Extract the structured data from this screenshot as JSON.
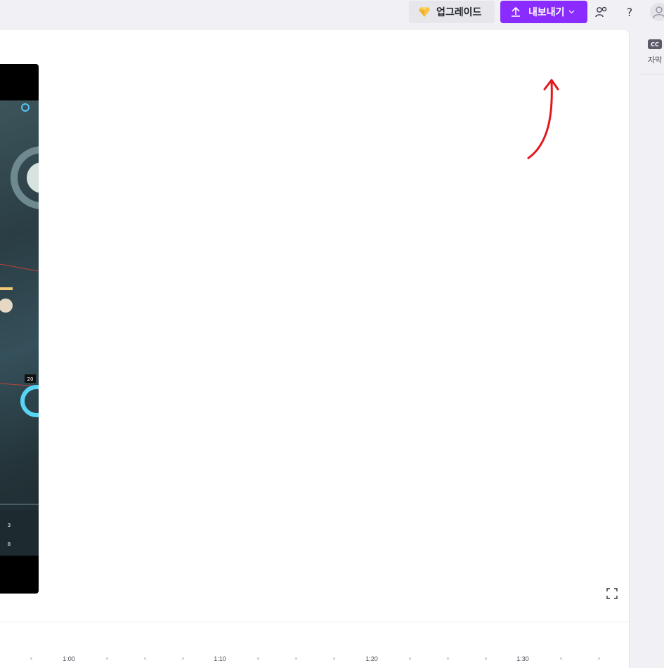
{
  "topbar": {
    "upgrade_label": "업그레이드",
    "export_label": "내보내기",
    "help_glyph": "?",
    "icons": {
      "upgrade": "diamond-icon",
      "export": "upload-arrow-icon",
      "export_dropdown": "chevron-down-icon",
      "share": "collaborators-icon",
      "help": "help-icon",
      "account": "user-avatar-icon"
    }
  },
  "preview": {
    "fullscreen_icon": "fullscreen-icon",
    "hud_values": [
      "20",
      "3",
      "8"
    ]
  },
  "timeline": {
    "ticks": [
      "1:00",
      "1:10",
      "1:20",
      "1:30"
    ]
  },
  "right_rail": {
    "captions_badge": "CC",
    "captions_label": "자막"
  },
  "colors": {
    "accent": "#8a2cff",
    "annotation_arrow": "#e0191f",
    "background": "#f0f0f5",
    "panel": "#ffffff"
  }
}
